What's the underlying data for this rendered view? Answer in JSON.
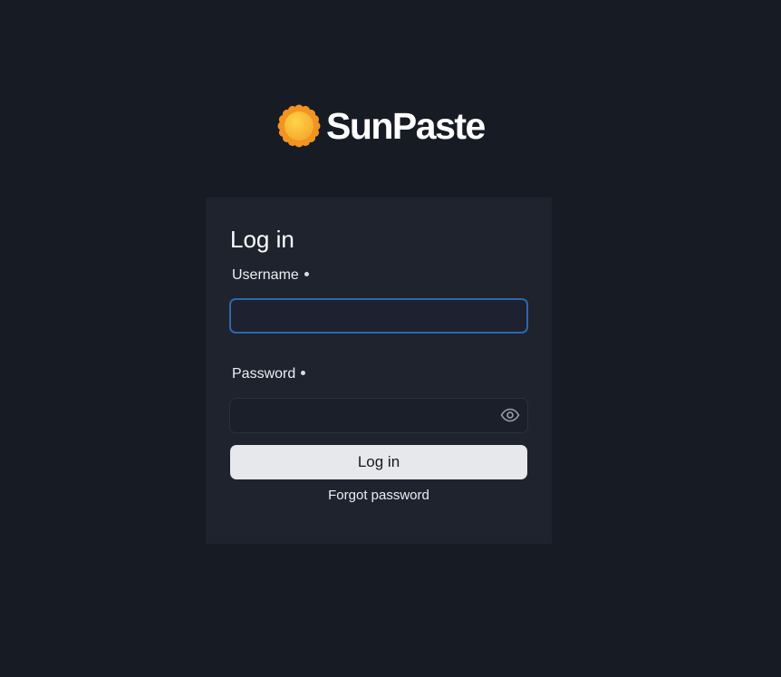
{
  "brand": {
    "name": "SunPaste",
    "logo_icon": "sun-icon",
    "colors": {
      "sun_outer": "#f39322",
      "sun_inner": "#fbbf26"
    }
  },
  "login": {
    "title": "Log in",
    "username": {
      "label": "Username",
      "value": "",
      "placeholder": "",
      "required": true
    },
    "password": {
      "label": "Password",
      "value": "",
      "placeholder": "",
      "required": true,
      "toggle_icon": "eye-icon"
    },
    "submit_label": "Log in",
    "forgot_label": "Forgot password"
  },
  "colors": {
    "page_background": "#171b24",
    "card_background": "#1f232e",
    "focus_border": "#2f67a8",
    "button_background": "#e6e8eb"
  }
}
